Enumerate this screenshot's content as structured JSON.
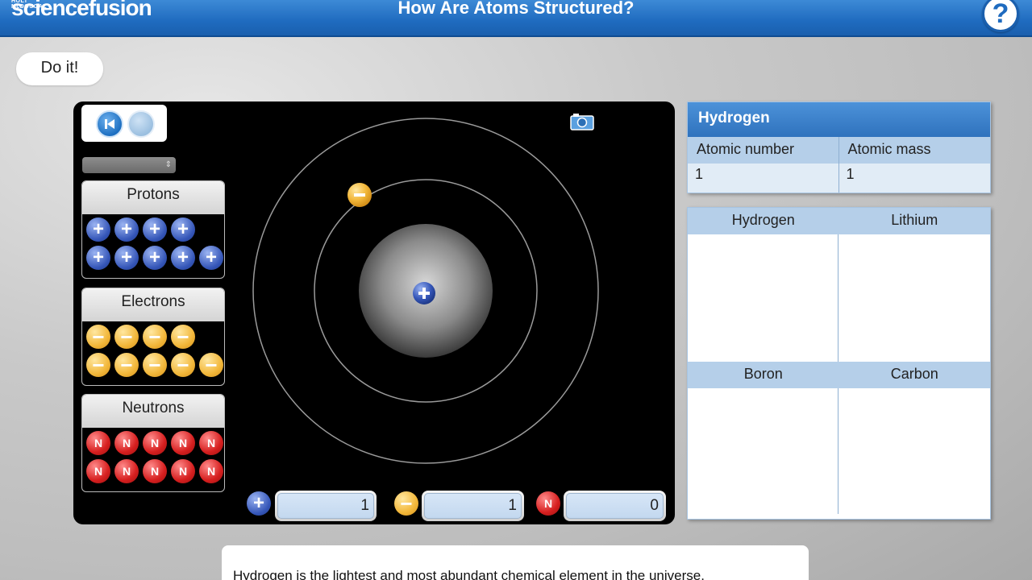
{
  "app": {
    "brand_small": "HOLT McDOUGAL",
    "brand": "sciencefusion",
    "title": "How Are Atoms Structured?",
    "help_label": "?"
  },
  "doit_label": "Do it!",
  "bins": {
    "protons": {
      "label": "Protons",
      "count": 9,
      "symbol": "+"
    },
    "electrons": {
      "label": "Electrons",
      "count": 9,
      "symbol": "−"
    },
    "neutrons": {
      "label": "Neutrons",
      "count": 10,
      "symbol": "N"
    }
  },
  "atom": {
    "nucleus_protons": 1,
    "orbit_electrons": 1
  },
  "counters": {
    "protons": "1",
    "electrons": "1",
    "neutrons": "0"
  },
  "element_info": {
    "name": "Hydrogen",
    "col_number": "Atomic number",
    "col_mass": "Atomic mass",
    "atomic_number": "1",
    "atomic_mass": "1"
  },
  "snapshots": {
    "top_left": "Hydrogen",
    "top_right": "Lithium",
    "bottom_left": "Boron",
    "bottom_right": "Carbon"
  },
  "caption": "Hydrogen is the lightest and most abundant chemical element in the universe.",
  "colors": {
    "header": "#1f6bbf",
    "proton": "#3556b8",
    "electron": "#f2b73a",
    "neutron": "#d61f1f"
  }
}
